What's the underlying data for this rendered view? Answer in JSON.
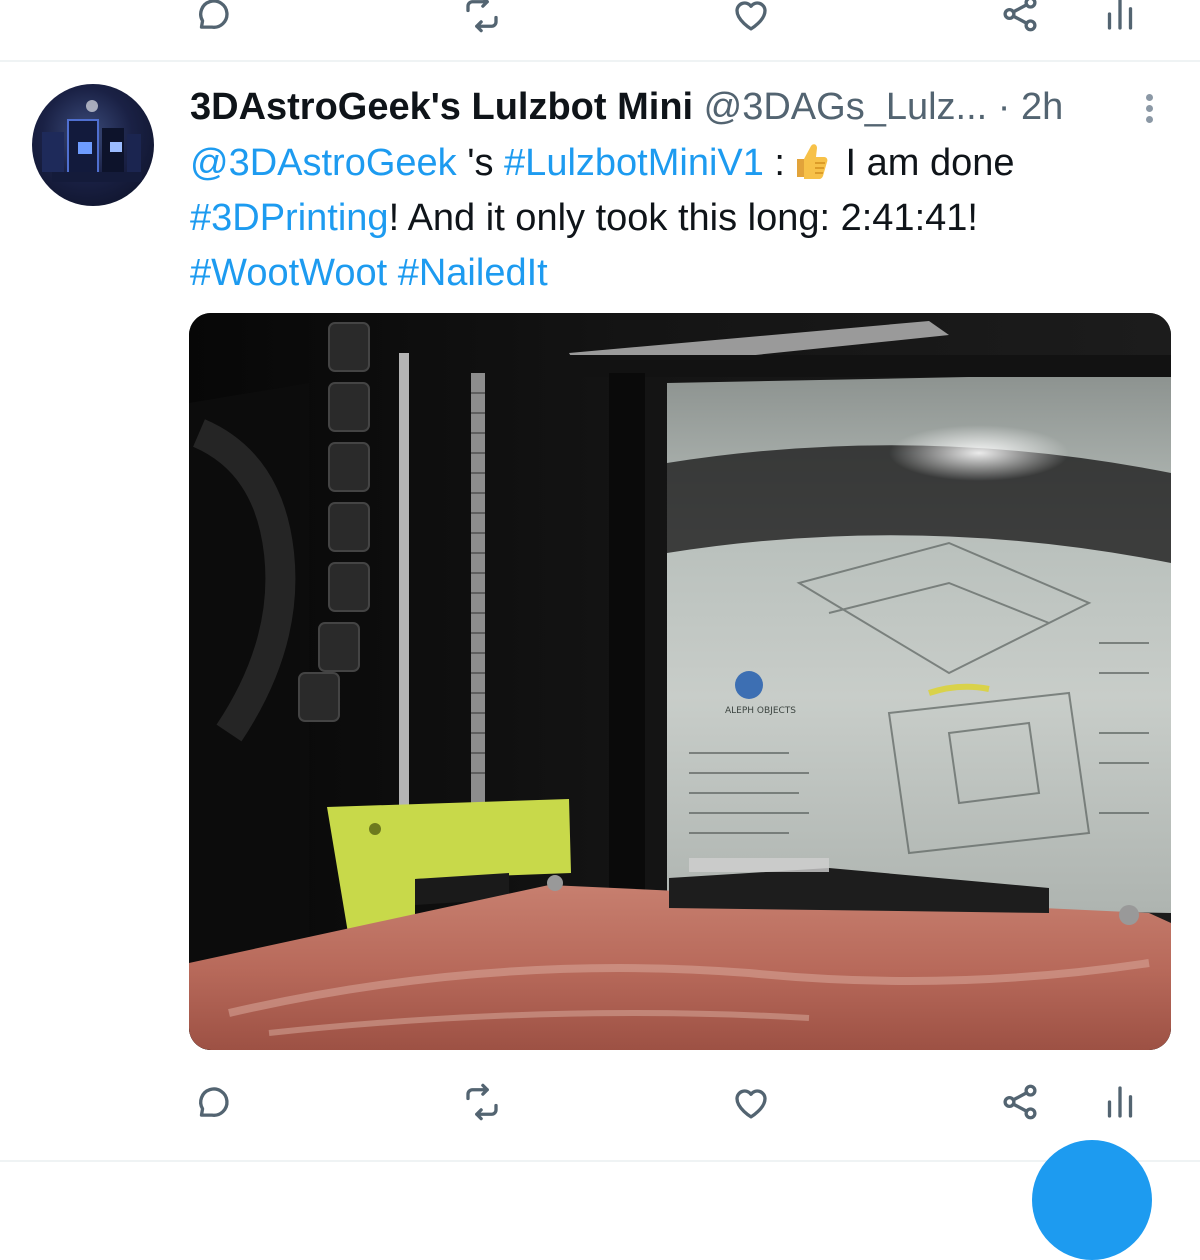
{
  "tweet": {
    "display_name": "3DAstroGeek's Lulzbot Mini",
    "handle": "@3DAGs_Lulz...",
    "separator": "·",
    "time": "2h",
    "text": {
      "mention": "@3DAstroGeek",
      "possessive": " 's ",
      "hashtag1": "#LulzbotMiniV1",
      "colon": " :",
      "emoji_name": "thumbs-up",
      "part1": " I am done ",
      "hashtag2": "#3DPrinting",
      "part2": "! And it only took this long: 2:41:41!",
      "hashtag3": "#WootWoot",
      "space": " ",
      "hashtag4": "#NailedIt"
    },
    "media": {
      "description_icon": "3d-printer-photo",
      "decal_text": "ALEPH OBJECTS"
    }
  },
  "actions": [
    {
      "icon": "reply-icon"
    },
    {
      "icon": "retweet-icon"
    },
    {
      "icon": "like-icon"
    },
    {
      "icon": "share-icon"
    },
    {
      "icon": "analytics-icon"
    }
  ],
  "colors": {
    "accent": "#1d9bf0",
    "text": "#0f1419",
    "secondary": "#536471",
    "divider": "#eff3f4"
  }
}
